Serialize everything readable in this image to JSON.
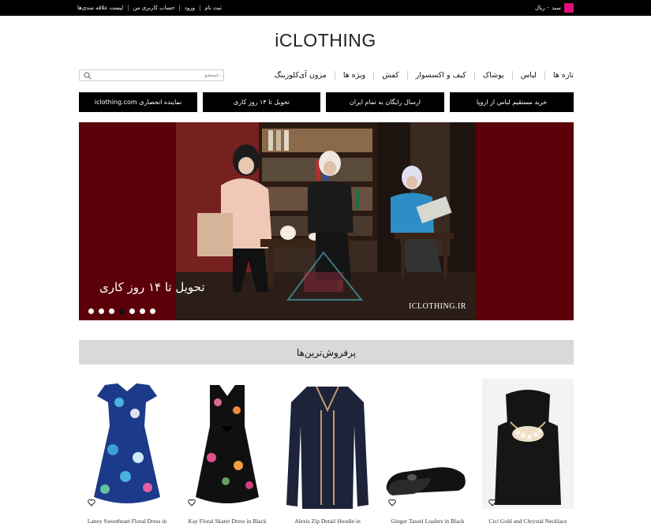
{
  "topbar": {
    "cart_label": "سبد",
    "cart_price": "- ریال",
    "links": [
      "ثبت نام",
      "ورود",
      "حساب کاربری من",
      "لیست علاقه مندی‌ها"
    ]
  },
  "logo": "iCLOTHING",
  "nav": {
    "items": [
      "تازه ها",
      "لباس",
      "پوشاک",
      "کیف و اکسسوار",
      "کفش",
      "ویژه ها",
      "مزون آی‌کلوزینگ"
    ],
    "search_placeholder": "جستجو..."
  },
  "promos": [
    "خرید مستقیم لباس از اروپا",
    "ارسال رایگان به تمام ایران",
    "تحویل تا ۱۴ روز کاری",
    "نماینده انحصاری iclothing.com"
  ],
  "banner": {
    "caption": "تحویل تا ۱۴ روز کاری",
    "brand_mark": "ICLOTHING.IR",
    "slide_count": 7,
    "active_slide": 4
  },
  "best_sellers": {
    "heading": "پرفروش‌ترین‌ها",
    "products": [
      {
        "title": "Cici Gold and Chrystal Necklace",
        "image": "necklace"
      },
      {
        "title": "Ginger Tassel Loafers in Black",
        "image": "loafers"
      },
      {
        "title": "Alexis Zip Detail Hoodie in",
        "image": "hoodie"
      },
      {
        "title": "Kay Floral Skater Dress in Black",
        "image": "skater-dress"
      },
      {
        "title": "Laney Sweetheart Floral Dress in",
        "image": "floral-dress"
      }
    ]
  },
  "colors": {
    "topbar": "#000000",
    "cart_accent": "#e0107a",
    "banner_bg": "#5b0008",
    "section_head_bg": "#d9d9d9"
  }
}
